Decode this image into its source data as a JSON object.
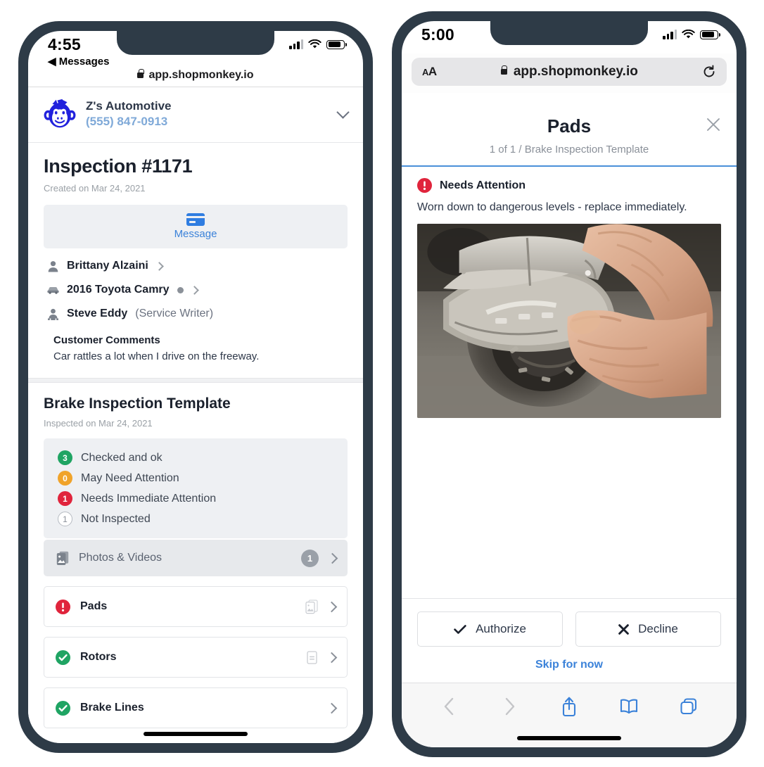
{
  "colors": {
    "brand_blue": "#3b82d9",
    "frame": "#2e3b47",
    "green": "#1fa463",
    "orange": "#f0a32a",
    "red": "#e0243c",
    "gray": "#9aa0a8",
    "rule_blue": "#4a90d9"
  },
  "left_phone": {
    "status": {
      "time": "4:55",
      "back_label": "◀ Messages",
      "signal_icon": "cellular-signal-icon",
      "wifi_icon": "wifi-icon",
      "battery_icon": "battery-icon"
    },
    "urlbar": {
      "lock_icon": "lock-icon",
      "url": "app.shopmonkey.io"
    },
    "shop": {
      "logo_icon": "shopmonkey-monkey-logo",
      "name": "Z's Automotive",
      "phone": "(555) 847-0913",
      "chevron_icon": "chevron-down-icon"
    },
    "inspection": {
      "title": "Inspection #1171",
      "created": "Created on Mar 24, 2021",
      "message_button": {
        "label": "Message",
        "icon": "message-card-icon"
      }
    },
    "meta_rows": [
      {
        "icon": "person-icon",
        "name": "Brittany Alzaini",
        "suffix": "",
        "has_dot": false,
        "chevron_icon": "chevron-right-icon"
      },
      {
        "icon": "car-icon",
        "name": "2016 Toyota Camry",
        "suffix": "",
        "has_dot": true,
        "chevron_icon": "chevron-right-icon"
      },
      {
        "icon": "service-writer-icon",
        "name": "Steve Eddy",
        "suffix": "(Service Writer)",
        "has_dot": false,
        "chevron_icon": ""
      }
    ],
    "customer_comments": {
      "title": "Customer Comments",
      "text": "Car rattles a lot when I drive on the freeway."
    },
    "template": {
      "title": "Brake Inspection Template",
      "inspected": "Inspected on Mar 24, 2021",
      "legend": [
        {
          "count": "3",
          "label": "Checked and ok",
          "color": "#1fa463",
          "style": "solid"
        },
        {
          "count": "0",
          "label": "May Need Attention",
          "color": "#f0a32a",
          "style": "solid"
        },
        {
          "count": "1",
          "label": "Needs Immediate Attention",
          "color": "#e0243c",
          "style": "solid"
        },
        {
          "count": "1",
          "label": "Not Inspected",
          "color": "#b6bbc2",
          "style": "outline"
        }
      ],
      "photos_row": {
        "icon": "photo-document-icon",
        "label": "Photos & Videos",
        "count": "1",
        "chevron_icon": "chevron-right-icon"
      },
      "items": [
        {
          "status": "alert",
          "label": "Pads",
          "has_doc_icon": true,
          "doc_icon": "photo-document-icon",
          "chevron_icon": "chevron-right-icon"
        },
        {
          "status": "ok",
          "label": "Rotors",
          "has_doc_icon": true,
          "doc_icon": "note-document-icon",
          "chevron_icon": "chevron-right-icon"
        },
        {
          "status": "ok",
          "label": "Brake Lines",
          "has_doc_icon": false,
          "doc_icon": "",
          "chevron_icon": "chevron-right-icon"
        }
      ]
    }
  },
  "right_phone": {
    "status": {
      "time": "5:00",
      "signal_icon": "cellular-signal-icon",
      "wifi_icon": "wifi-icon",
      "battery_icon": "battery-icon"
    },
    "urlbar": {
      "text_size_label": "A",
      "text_size_label_small": "A",
      "lock_icon": "lock-icon",
      "url": "app.shopmonkey.io",
      "reload_icon": "reload-icon"
    },
    "modal": {
      "title": "Pads",
      "subtitle": "1 of 1 / Brake Inspection Template",
      "close_icon": "close-icon",
      "status_icon": "alert-circle-icon",
      "status_label": "Needs Attention",
      "description": "Worn down to dangerous levels - replace immediately.",
      "photo_alt": "brake-pads-photo"
    },
    "actions": {
      "authorize": {
        "label": "Authorize",
        "icon": "checkmark-icon"
      },
      "decline": {
        "label": "Decline",
        "icon": "x-mark-icon"
      },
      "skip": {
        "label": "Skip for now"
      }
    },
    "toolbar": [
      {
        "icon": "back-chevron-icon",
        "state": "disabled"
      },
      {
        "icon": "forward-chevron-icon",
        "state": "disabled"
      },
      {
        "icon": "share-icon",
        "state": "enabled"
      },
      {
        "icon": "bookmarks-book-icon",
        "state": "enabled"
      },
      {
        "icon": "tabs-icon",
        "state": "enabled"
      }
    ]
  }
}
